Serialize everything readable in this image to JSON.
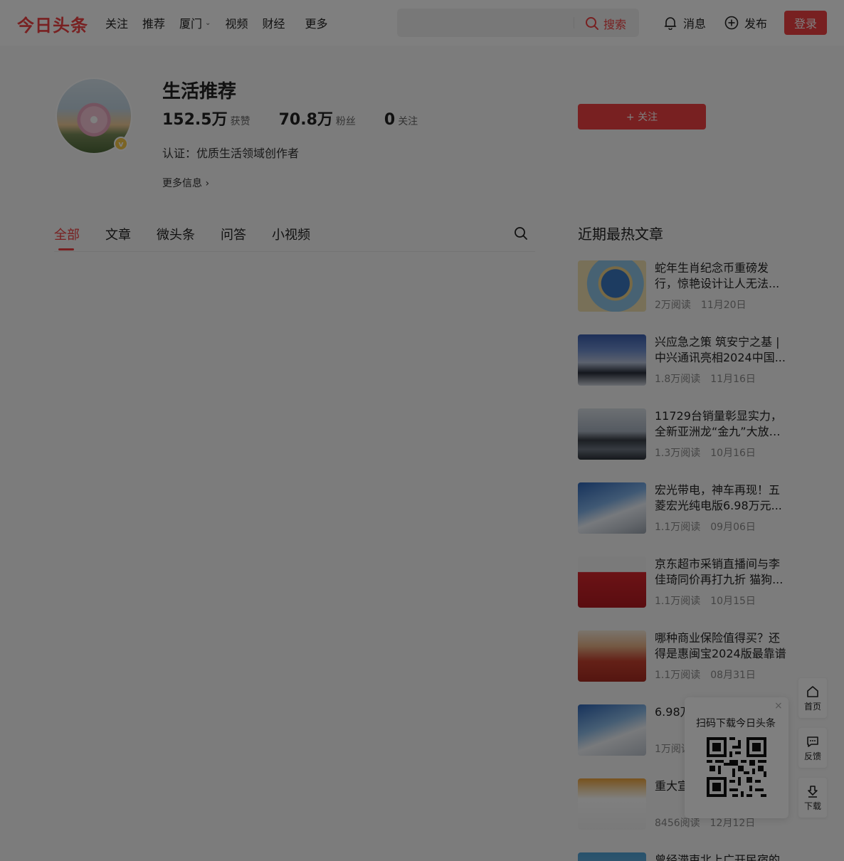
{
  "header": {
    "logo": "今日头条",
    "nav": [
      "关注",
      "推荐",
      "厦门",
      "视频",
      "财经",
      "更多"
    ],
    "search_placeholder": "",
    "search_label": "搜索",
    "messages_label": "消息",
    "publish_label": "发布",
    "login_label": "登录"
  },
  "profile": {
    "name": "生活推荐",
    "likes_num": "152.5万",
    "likes_label": "获赞",
    "fans_num": "70.8万",
    "fans_label": "粉丝",
    "following_num": "0",
    "following_label": "关注",
    "certification": "认证：优质生活领域创作者",
    "more_info": "更多信息 ›",
    "follow_label": "+ 关注"
  },
  "tabs": [
    "全部",
    "文章",
    "微头条",
    "问答",
    "小视频"
  ],
  "hot": {
    "title": "近期最热文章",
    "articles": [
      {
        "title": "蛇年生肖纪念币重磅发行，惊艳设计让人无法...",
        "reads": "2万阅读",
        "date": "11月20日"
      },
      {
        "title": "兴应急之策 筑安宁之基 | 中兴通讯亮相2024中国...",
        "reads": "1.8万阅读",
        "date": "11月16日"
      },
      {
        "title": "11729台销量彰显实力，全新亚洲龙“金九”大放异彩",
        "reads": "1.3万阅读",
        "date": "10月16日"
      },
      {
        "title": "宏光带电，神车再现！五菱宏光纯电版6.98万元...",
        "reads": "1.1万阅读",
        "date": "09月06日"
      },
      {
        "title": "京东超市采销直播间与李佳琦同价再打九折 猫狗...",
        "reads": "1.1万阅读",
        "date": "10月15日"
      },
      {
        "title": "哪种商业保险值得买？还得是惠闽宝2024版最靠谱",
        "reads": "1.1万阅读",
        "date": "08月31日"
      },
      {
        "title": "6.98万 神车一",
        "reads": "1万阅读",
        "date": ""
      },
      {
        "title": "重大宣 人养老",
        "reads": "8456阅读",
        "date": "12月12日"
      },
      {
        "title": "曾经滞束北上广开民宿的",
        "reads": "",
        "date": ""
      }
    ]
  },
  "qr": {
    "close": "×",
    "text": "扫码下载今日头条"
  },
  "side": {
    "home": "首页",
    "feedback": "反馈",
    "download": "下载"
  },
  "colors": {
    "brand": "#f04142",
    "text": "#222222",
    "muted": "#888888"
  }
}
